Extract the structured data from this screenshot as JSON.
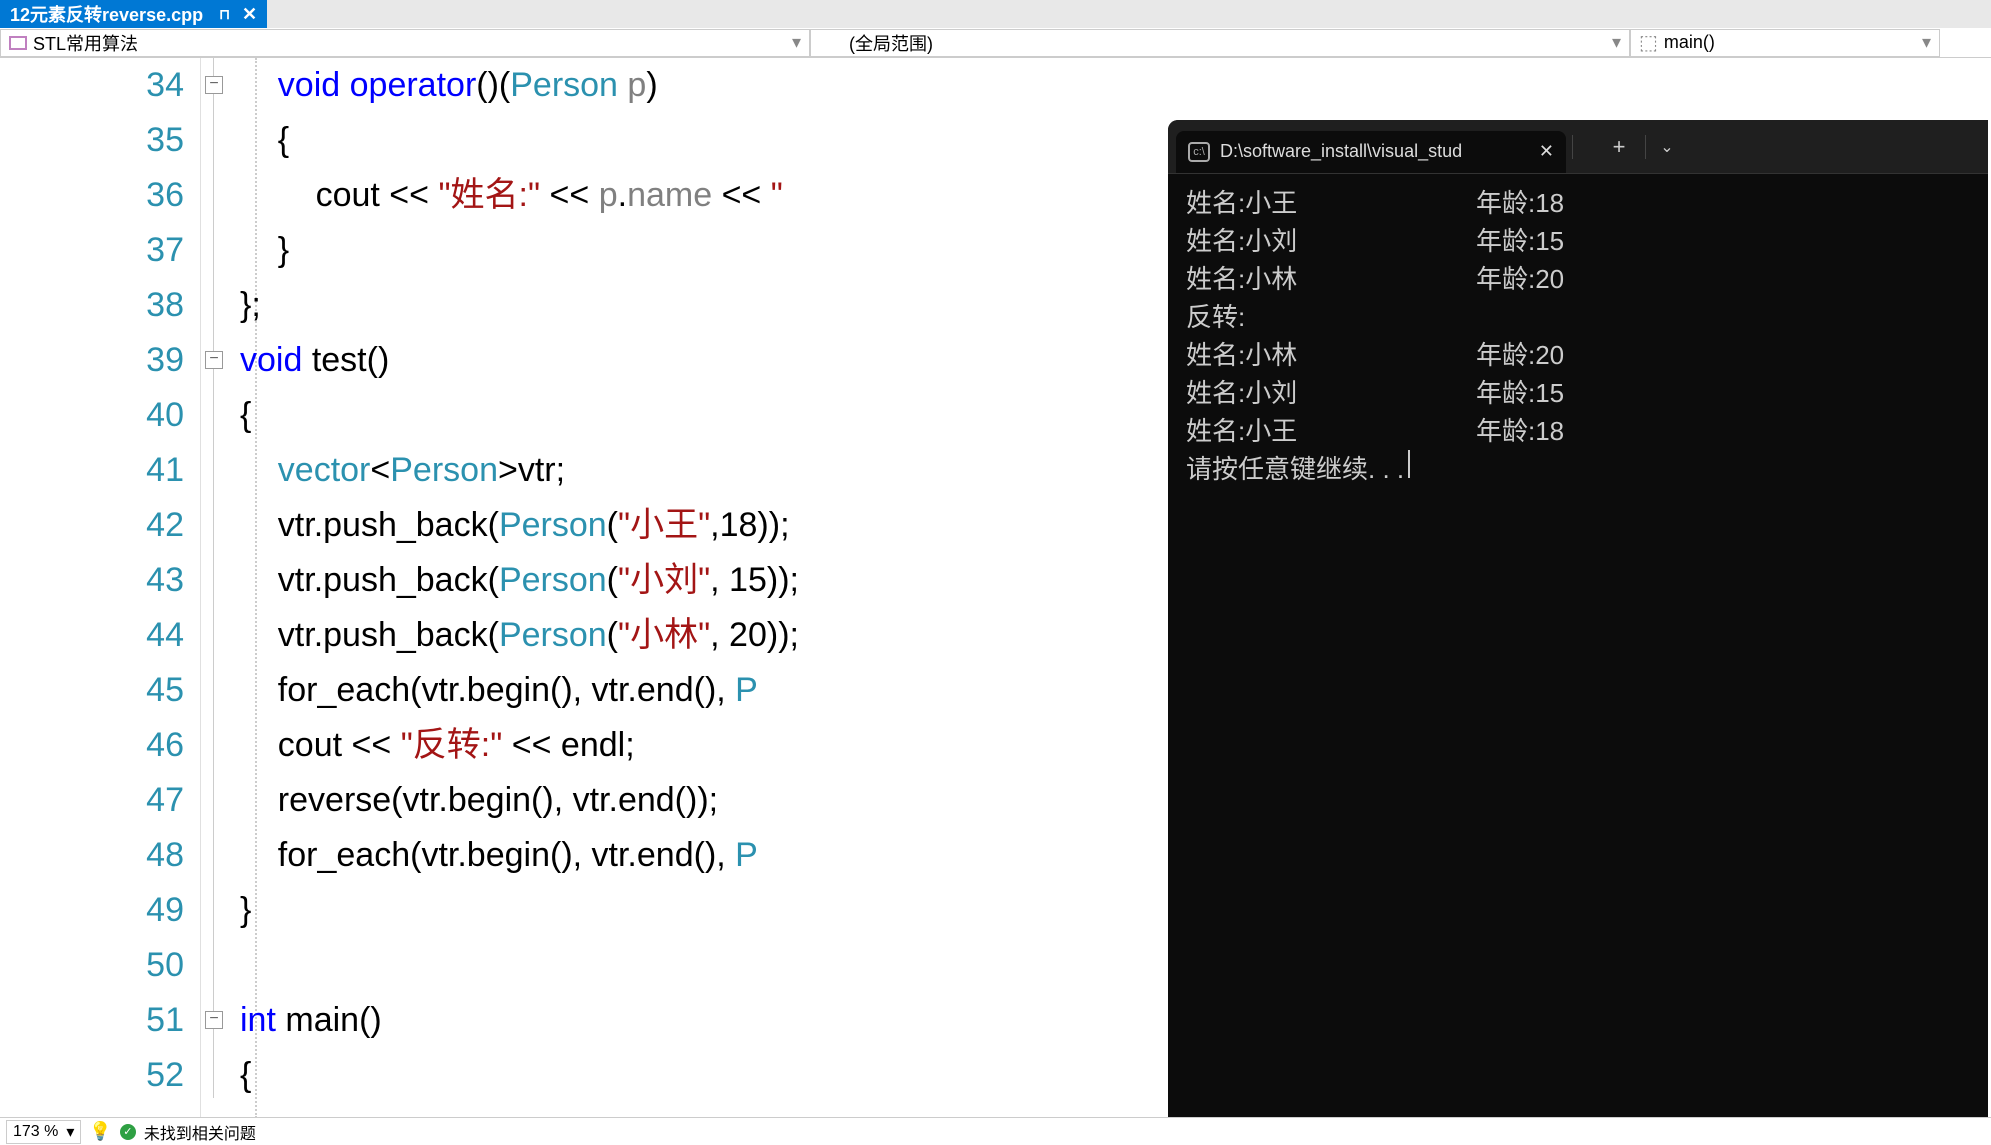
{
  "file_tab": {
    "name": "12元素反转reverse.cpp"
  },
  "nav": {
    "scope": "STL常用算法",
    "global": "(全局范围)",
    "main": "main()"
  },
  "code": {
    "lines_start": 34,
    "lines_end": 52,
    "l34": {
      "p1": "void",
      "p2": " ",
      "p3": "operator",
      "p4": "()(",
      "p5": "Person",
      "p6": " ",
      "p7": "p",
      "p8": ")"
    },
    "l35": "{",
    "l36": {
      "p1": "cout ",
      "p2": "<<",
      "p3": " ",
      "p4": "\"姓名:\"",
      "p5": " ",
      "p6": "<<",
      "p7": " ",
      "p8": "p",
      "p9": ".",
      "p10": "name",
      "p11": " ",
      "p12": "<<",
      "p13": " ",
      "p14": "\""
    },
    "l37": "}",
    "l38": "};",
    "l39": {
      "p1": "void",
      "p2": " ",
      "p3": "test",
      "p4": "()"
    },
    "l40": "{",
    "l41": {
      "p1": "vector",
      "p2": "<",
      "p3": "Person",
      "p4": ">",
      "p5": "vtr",
      "p6": ";"
    },
    "l42": {
      "p1": "vtr.",
      "p2": "push_back",
      "p3": "(",
      "p4": "Person",
      "p5": "(",
      "p6": "\"小王\"",
      "p7": ",",
      "p8": "18",
      "p9": "));"
    },
    "l43": {
      "p1": "vtr.",
      "p2": "push_back",
      "p3": "(",
      "p4": "Person",
      "p5": "(",
      "p6": "\"小刘\"",
      "p7": ", ",
      "p8": "15",
      "p9": "));"
    },
    "l44": {
      "p1": "vtr.",
      "p2": "push_back",
      "p3": "(",
      "p4": "Person",
      "p5": "(",
      "p6": "\"小林\"",
      "p7": ", ",
      "p8": "20",
      "p9": "));"
    },
    "l45": {
      "p1": "for_each",
      "p2": "(vtr.",
      "p3": "begin",
      "p4": "(), vtr.",
      "p5": "end",
      "p6": "(), ",
      "p7": "P"
    },
    "l46": {
      "p1": "cout ",
      "p2": "<<",
      "p3": " ",
      "p4": "\"反转:\"",
      "p5": " ",
      "p6": "<<",
      "p7": " ",
      "p8": "endl",
      "p9": ";"
    },
    "l47": {
      "p1": "reverse",
      "p2": "(vtr.",
      "p3": "begin",
      "p4": "(), vtr.",
      "p5": "end",
      "p6": "());"
    },
    "l48": {
      "p1": "for_each",
      "p2": "(vtr.",
      "p3": "begin",
      "p4": "(), vtr.",
      "p5": "end",
      "p6": "(), ",
      "p7": "P"
    },
    "l49": "}",
    "l50": "",
    "l51": {
      "p1": "int",
      "p2": " ",
      "p3": "main",
      "p4": "()"
    },
    "l52": "{"
  },
  "terminal": {
    "title": "D:\\software_install\\visual_stud",
    "rows": [
      {
        "c1": "姓名:小王",
        "c2": "年龄:18"
      },
      {
        "c1": "姓名:小刘",
        "c2": "年龄:15"
      },
      {
        "c1": "姓名:小林",
        "c2": "年龄:20"
      },
      {
        "c1": "反转:",
        "c2": ""
      },
      {
        "c1": "姓名:小林",
        "c2": "年龄:20"
      },
      {
        "c1": "姓名:小刘",
        "c2": "年龄:15"
      },
      {
        "c1": "姓名:小王",
        "c2": "年龄:18"
      }
    ],
    "prompt": "请按任意键继续. . ."
  },
  "status": {
    "zoom": "173 %",
    "issues": "未找到相关问题"
  },
  "line_numbers": [
    "34",
    "35",
    "36",
    "37",
    "38",
    "39",
    "40",
    "41",
    "42",
    "43",
    "44",
    "45",
    "46",
    "47",
    "48",
    "49",
    "50",
    "51",
    "52"
  ]
}
